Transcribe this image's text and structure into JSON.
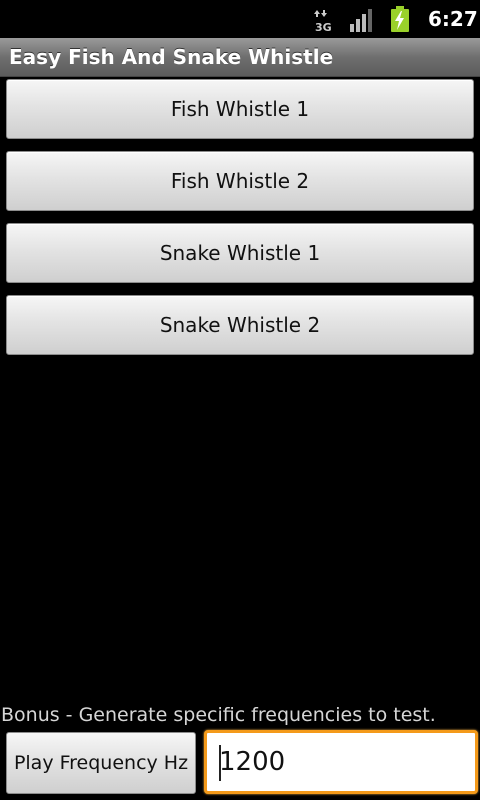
{
  "status_bar": {
    "network_type": "3G",
    "time": "6:27"
  },
  "title_bar": {
    "title": "Easy Fish And Snake Whistle"
  },
  "buttons": [
    {
      "label": "Fish Whistle 1"
    },
    {
      "label": "Fish Whistle 2"
    },
    {
      "label": "Snake Whistle 1"
    },
    {
      "label": "Snake Whistle 2"
    }
  ],
  "bonus": {
    "label": "Bonus - Generate specific frequencies to test.",
    "play_button_label": "Play Frequency Hz",
    "frequency_value": "1200"
  },
  "colors": {
    "input_focus": "#f49a1a",
    "battery": "#9ad12a"
  }
}
